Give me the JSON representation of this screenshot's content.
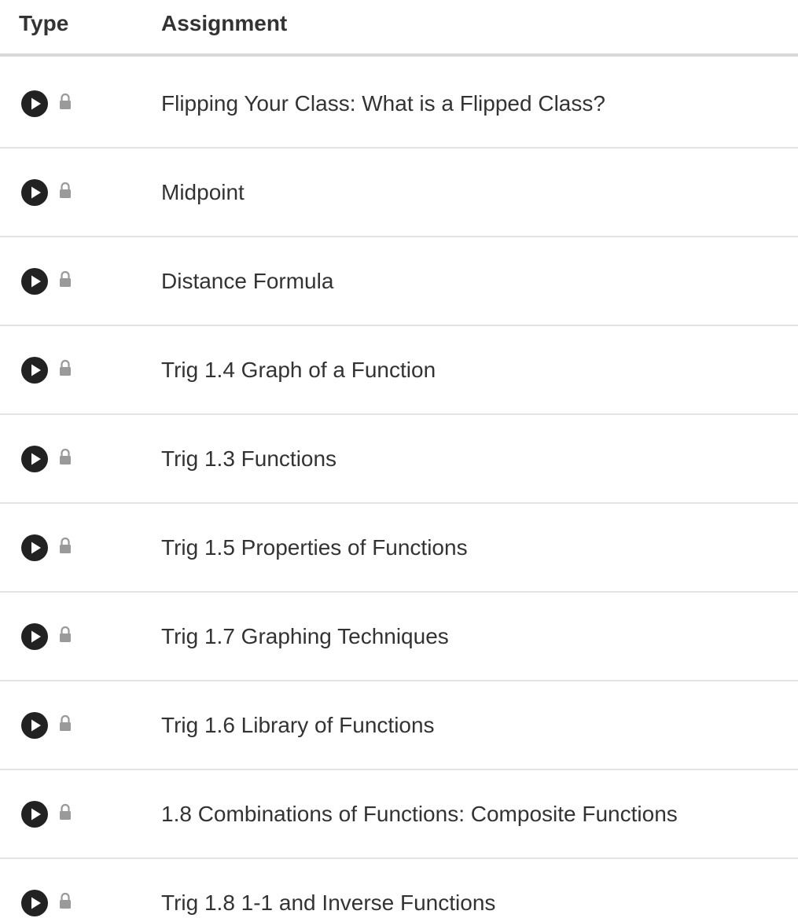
{
  "header": {
    "type_label": "Type",
    "assignment_label": "Assignment"
  },
  "rows": [
    {
      "title": "Flipping Your Class: What is a Flipped Class?",
      "type_icon": "play-icon",
      "status_icon": "lock-icon"
    },
    {
      "title": "Midpoint",
      "type_icon": "play-icon",
      "status_icon": "lock-icon"
    },
    {
      "title": "Distance Formula",
      "type_icon": "play-icon",
      "status_icon": "lock-icon"
    },
    {
      "title": "Trig 1.4 Graph of a Function",
      "type_icon": "play-icon",
      "status_icon": "lock-icon"
    },
    {
      "title": "Trig 1.3 Functions",
      "type_icon": "play-icon",
      "status_icon": "lock-icon"
    },
    {
      "title": "Trig 1.5 Properties of Functions",
      "type_icon": "play-icon",
      "status_icon": "lock-icon"
    },
    {
      "title": "Trig 1.7 Graphing Techniques",
      "type_icon": "play-icon",
      "status_icon": "lock-icon"
    },
    {
      "title": "Trig 1.6 Library of Functions",
      "type_icon": "play-icon",
      "status_icon": "lock-icon"
    },
    {
      "title": "1.8 Combinations of Functions: Composite Functions",
      "type_icon": "play-icon",
      "status_icon": "lock-icon"
    },
    {
      "title": "Trig 1.8 1-1 and Inverse Functions",
      "type_icon": "play-icon",
      "status_icon": "lock-icon"
    }
  ],
  "colors": {
    "text": "#333333",
    "icon_dark": "#222222",
    "icon_lock": "#999999",
    "divider": "#e3e3e3",
    "header_divider": "#d9d9d9"
  }
}
